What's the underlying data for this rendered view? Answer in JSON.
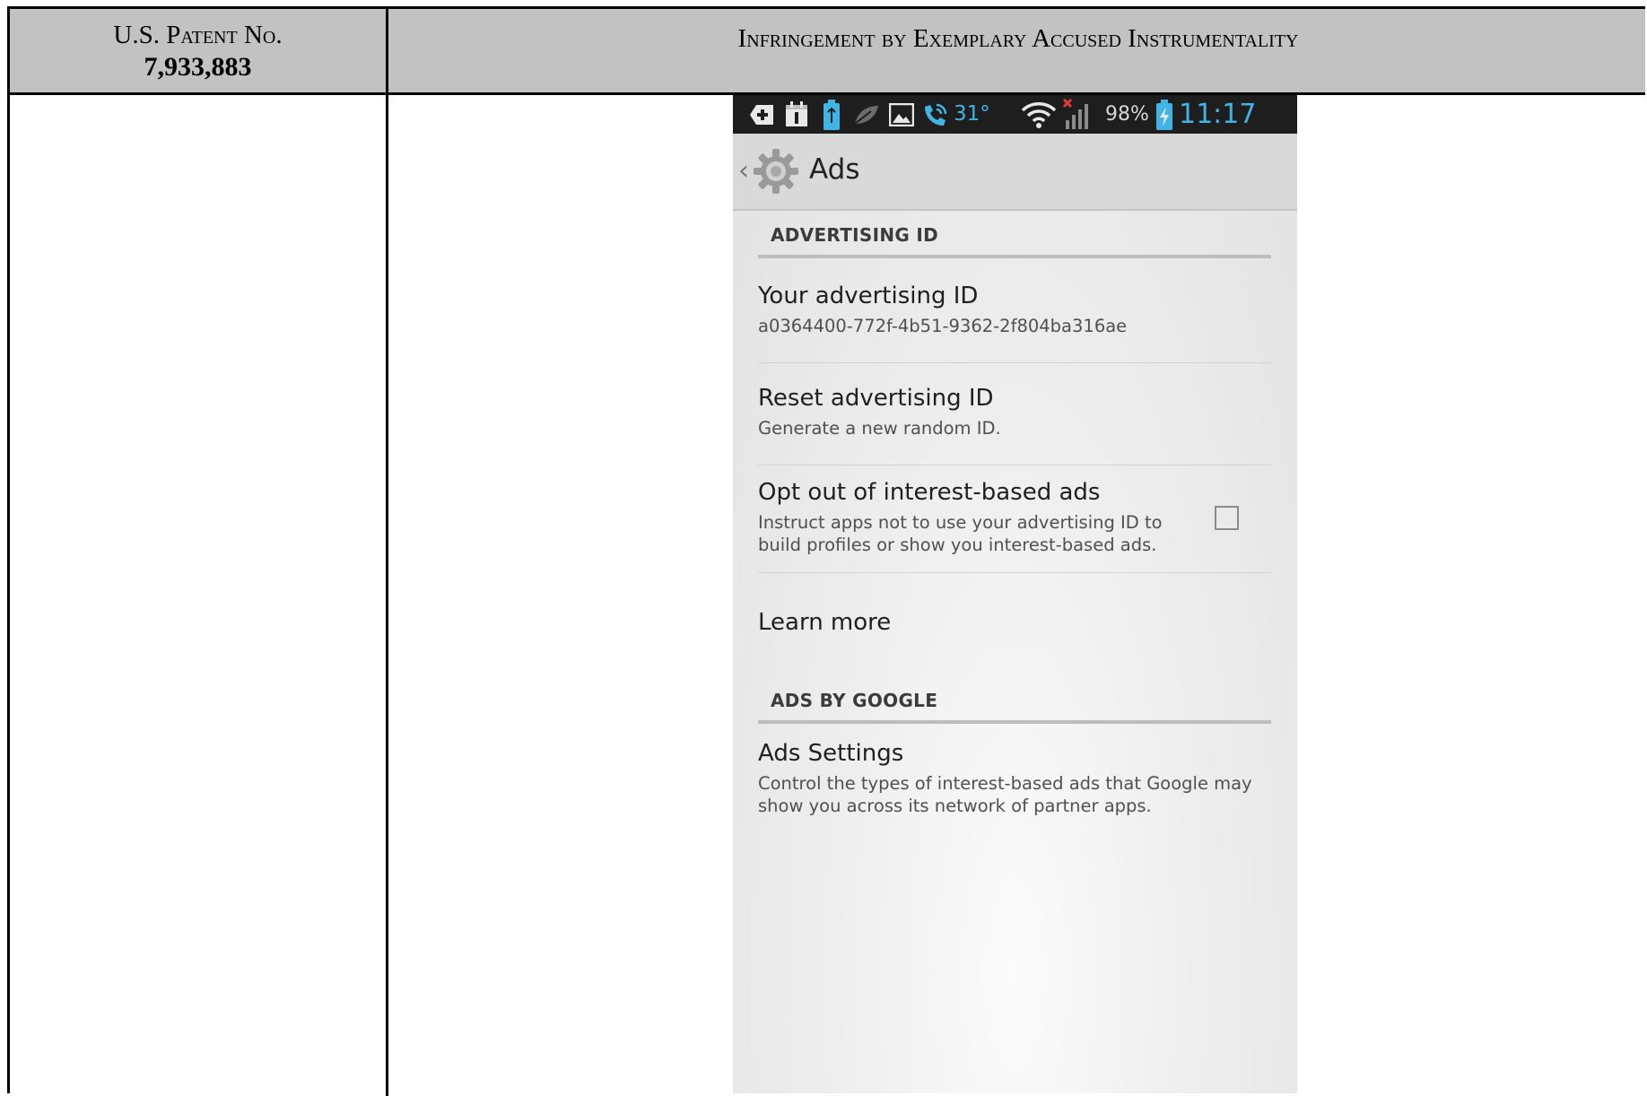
{
  "table": {
    "col1_header_line1": "U.S. Patent No.",
    "col1_header_line2": "7,933,883",
    "col2_header": "Infringement by Exemplary Accused Instrumentality"
  },
  "phone": {
    "status_bar": {
      "icons": [
        "add-box-icon",
        "calendar-icon",
        "battery-usb-icon",
        "leaf-icon",
        "image-icon",
        "wifi-calling-icon",
        "wifi-icon",
        "no-signal-icon",
        "battery-charging-icon"
      ],
      "temperature": "31°",
      "battery_percent": "98%",
      "time": "11:17 PM"
    },
    "action_bar": {
      "title": "Ads",
      "icon": "settings-gear-icon"
    },
    "sections": {
      "advertising_id": {
        "header": "ADVERTISING ID",
        "your_id_title": "Your advertising ID",
        "your_id_value": "a0364400-772f-4b51-9362-2f804ba316ae",
        "reset_title": "Reset advertising ID",
        "reset_summary": "Generate a new random ID.",
        "opt_out_title": "Opt out of interest-based ads",
        "opt_out_summary": "Instruct apps not to use your advertising ID to build profiles or show you interest-based ads.",
        "opt_out_checked": false,
        "learn_more": "Learn more"
      },
      "ads_by_google": {
        "header": "ADS BY GOOGLE",
        "settings_title": "Ads Settings",
        "settings_summary": "Control the types of interest-based ads that Google may show you across its network of partner apps."
      }
    }
  }
}
